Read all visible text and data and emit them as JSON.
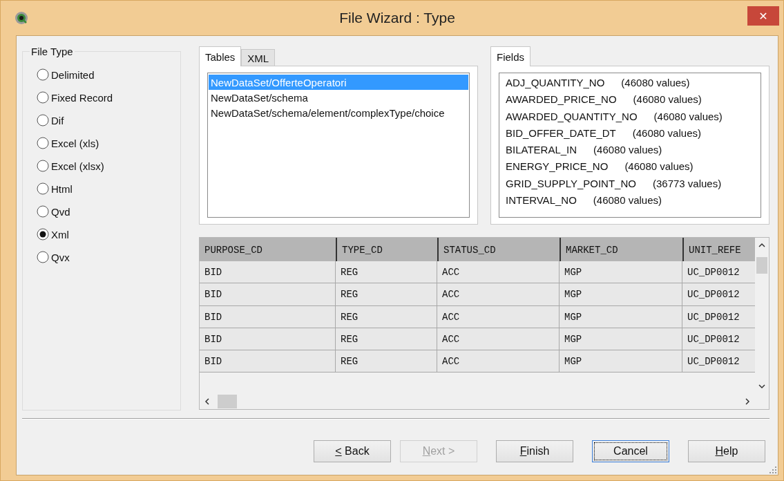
{
  "window": {
    "title": "File Wizard : Type",
    "close": "✕"
  },
  "file_type": {
    "label": "File Type",
    "options": [
      {
        "label": "Delimited",
        "selected": false
      },
      {
        "label": "Fixed Record",
        "selected": false
      },
      {
        "label": "Dif",
        "selected": false
      },
      {
        "label": "Excel (xls)",
        "selected": false
      },
      {
        "label": "Excel (xlsx)",
        "selected": false
      },
      {
        "label": "Html",
        "selected": false
      },
      {
        "label": "Qvd",
        "selected": false
      },
      {
        "label": "Xml",
        "selected": true
      },
      {
        "label": "Qvx",
        "selected": false
      }
    ]
  },
  "tables_tabs": [
    {
      "label": "Tables",
      "selected": true
    },
    {
      "label": "XML",
      "selected": false
    }
  ],
  "tables": [
    {
      "label": "NewDataSet/OfferteOperatori",
      "selected": true
    },
    {
      "label": "NewDataSet/schema",
      "selected": false
    },
    {
      "label": "NewDataSet/schema/element/complexType/choice",
      "selected": false
    }
  ],
  "fields_tab": {
    "label": "Fields",
    "selected": true
  },
  "fields": [
    {
      "name": "ADJ_QUANTITY_NO",
      "count": "(46080 values)"
    },
    {
      "name": "AWARDED_PRICE_NO",
      "count": "(46080 values)"
    },
    {
      "name": "AWARDED_QUANTITY_NO",
      "count": "(46080 values)"
    },
    {
      "name": "BID_OFFER_DATE_DT",
      "count": "(46080 values)"
    },
    {
      "name": "BILATERAL_IN",
      "count": "(46080 values)"
    },
    {
      "name": "ENERGY_PRICE_NO",
      "count": "(46080 values)"
    },
    {
      "name": "GRID_SUPPLY_POINT_NO",
      "count": "(36773 values)"
    },
    {
      "name": "INTERVAL_NO",
      "count": "(46080 values)"
    }
  ],
  "preview": {
    "columns": [
      "PURPOSE_CD",
      "TYPE_CD",
      "STATUS_CD",
      "MARKET_CD",
      "UNIT_REFE"
    ],
    "rows": [
      [
        "BID",
        "REG",
        "ACC",
        "MGP",
        "UC_DP0012"
      ],
      [
        "BID",
        "REG",
        "ACC",
        "MGP",
        "UC_DP0012"
      ],
      [
        "BID",
        "REG",
        "ACC",
        "MGP",
        "UC_DP0012"
      ],
      [
        "BID",
        "REG",
        "ACC",
        "MGP",
        "UC_DP0012"
      ],
      [
        "BID",
        "REG",
        "ACC",
        "MGP",
        "UC_DP0012"
      ]
    ]
  },
  "buttons": [
    {
      "label": "< Back",
      "mnemonic": true,
      "disabled": false,
      "focused": false
    },
    {
      "label": "Next >",
      "mnemonic": true,
      "disabled": true,
      "focused": false
    },
    {
      "label": "Finish",
      "mnemonic": true,
      "disabled": false,
      "focused": false
    },
    {
      "label": "Cancel",
      "mnemonic": false,
      "disabled": false,
      "focused": true
    },
    {
      "label": "Help",
      "mnemonic": true,
      "disabled": false,
      "focused": false
    }
  ]
}
